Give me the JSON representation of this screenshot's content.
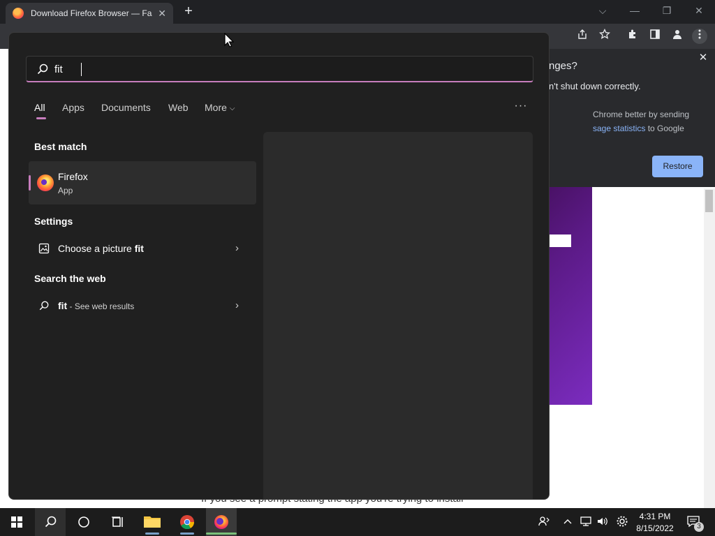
{
  "browser": {
    "tab_title": "Download Firefox Browser — Fast",
    "tab_close": "✕",
    "new_tab": "+",
    "window_controls": {
      "dropdown": "⌵",
      "minimize": "—",
      "restore": "❐",
      "close": "✕"
    },
    "toolbar_icons": [
      "share-icon",
      "star-icon",
      "extensions-icon",
      "sidepanel-icon",
      "profile-icon",
      "menu-icon"
    ]
  },
  "restore_bubble": {
    "title_fragment": "nges?",
    "description_fragment": "n't shut down correctly.",
    "option_line1": "Chrome better by sending",
    "option_link": "sage statistics",
    "option_suffix": " to Google",
    "restore_label": "Restore",
    "close": "✕"
  },
  "page": {
    "bottom_text": "If you see a prompt stating the app you're trying to install"
  },
  "search": {
    "query": "fit",
    "filters": [
      {
        "label": "All",
        "active": true
      },
      {
        "label": "Apps"
      },
      {
        "label": "Documents"
      },
      {
        "label": "Web"
      },
      {
        "label": "More"
      }
    ],
    "options": "···",
    "sections": {
      "best_match": "Best match",
      "settings": "Settings",
      "search_web": "Search the web"
    },
    "best_match": {
      "name": "Firefox",
      "type": "App"
    },
    "settings_item": {
      "prefix": "Choose a picture ",
      "bold": "fit"
    },
    "web_item": {
      "bold": "fit",
      "suffix": " - See web results"
    }
  },
  "taskbar": {
    "time": "4:31 PM",
    "date": "8/15/2022",
    "notifications": "3",
    "accent": "#c77dbd"
  }
}
